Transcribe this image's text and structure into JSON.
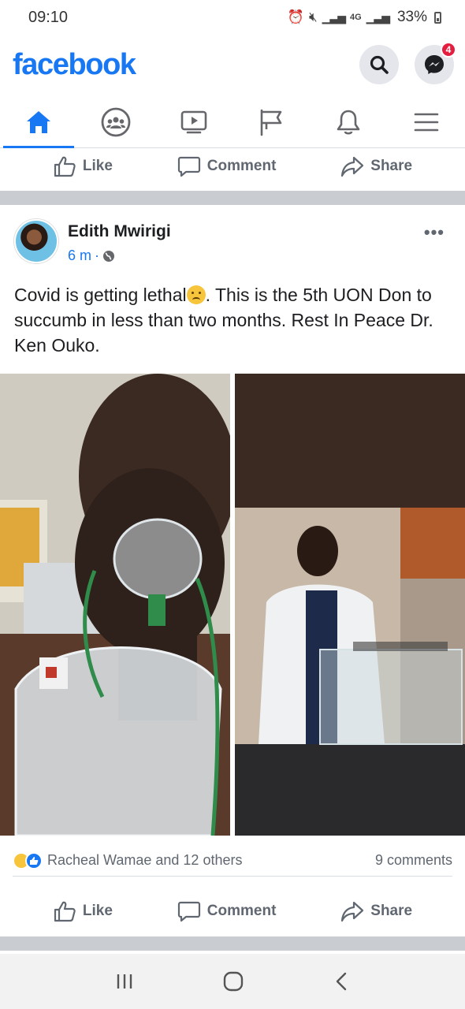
{
  "status_bar": {
    "time": "09:10",
    "network": "4G",
    "battery": "33%"
  },
  "header": {
    "logo": "facebook",
    "messenger_badge": "4"
  },
  "nav_tabs": [
    {
      "name": "home-icon",
      "active": true
    },
    {
      "name": "groups-icon",
      "active": false
    },
    {
      "name": "watch-icon",
      "active": false
    },
    {
      "name": "pages-icon",
      "active": false
    },
    {
      "name": "notifications-icon",
      "active": false
    },
    {
      "name": "menu-icon",
      "active": false
    }
  ],
  "actions": {
    "like": "Like",
    "comment": "Comment",
    "share": "Share"
  },
  "post": {
    "author": "Edith Mwirigi",
    "time": "6 m",
    "text_part1": "Covid is getting lethal",
    "text_part2": ". This is the 5th UON Don to succumb in less than two months. Rest In Peace Dr. Ken Ouko.",
    "reactions_text": "Racheal Wamae and 12 others",
    "comments_count": "9 comments"
  },
  "colors": {
    "brand": "#1877f2",
    "badge": "#e41e3f",
    "divider": "#c9ccd1"
  }
}
